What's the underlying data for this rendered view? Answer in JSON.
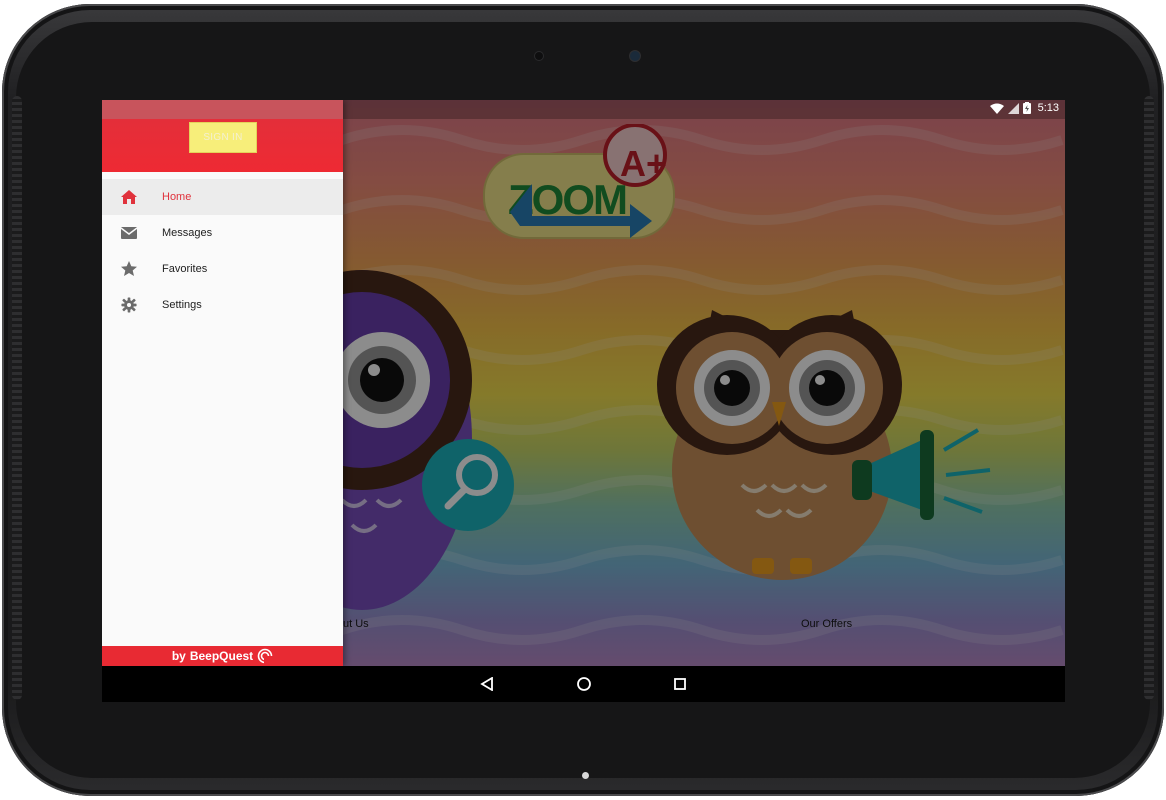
{
  "status_bar": {
    "time": "5:13"
  },
  "drawer": {
    "signin_label": "SIGN IN",
    "menu_items": [
      {
        "label": "Home",
        "icon": "home-icon",
        "active": true
      },
      {
        "label": "Messages",
        "icon": "mail-icon",
        "active": false
      },
      {
        "label": "Favorites",
        "icon": "star-icon",
        "active": false
      },
      {
        "label": "Settings",
        "icon": "gear-icon",
        "active": false
      }
    ],
    "footer_by": "by",
    "footer_brand": "BeepQuest"
  },
  "content": {
    "logo_text": "ZOOM",
    "logo_badge": "A+",
    "about_label": "ut Us",
    "offers_label": "Our Offers"
  },
  "colors": {
    "accent_red": "#e82a33",
    "signin_yellow": "#f7ee7a",
    "active_row": "#ececec"
  }
}
